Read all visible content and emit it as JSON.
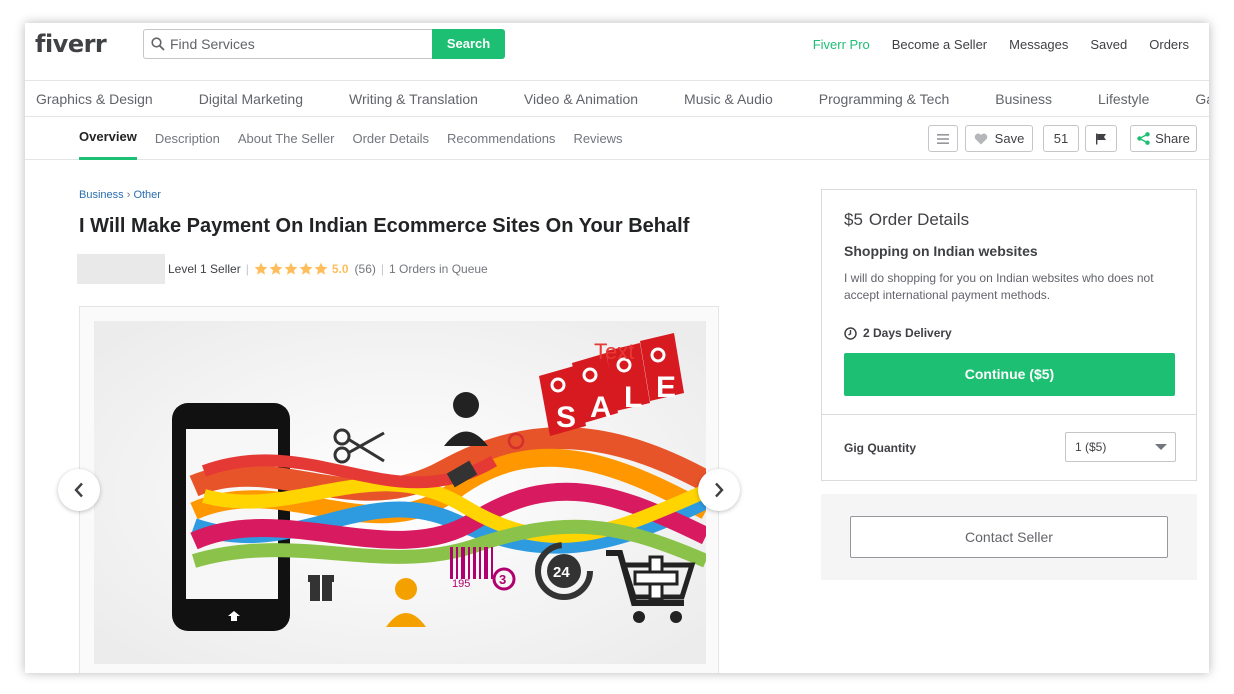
{
  "header": {
    "logo": "fiverr",
    "search_placeholder": "Find Services",
    "search_button": "Search",
    "nav": [
      {
        "label": "Fiverr Pro"
      },
      {
        "label": "Become a Seller"
      },
      {
        "label": "Messages"
      },
      {
        "label": "Saved"
      },
      {
        "label": "Orders"
      }
    ]
  },
  "categories": [
    "Graphics & Design",
    "Digital Marketing",
    "Writing & Translation",
    "Video & Animation",
    "Music & Audio",
    "Programming & Tech",
    "Business",
    "Lifestyle",
    "Gaming"
  ],
  "subnav": {
    "tabs": [
      "Overview",
      "Description",
      "About The Seller",
      "Order Details",
      "Recommendations",
      "Reviews"
    ],
    "active": "Overview",
    "save_label": "Save",
    "save_count": "51",
    "share_label": "Share"
  },
  "gig": {
    "breadcrumb": [
      "Business",
      "Other"
    ],
    "breadcrumb_sep": "›",
    "title": "I Will Make Payment On Indian Ecommerce Sites On Your Behalf",
    "seller_level": "Level 1 Seller",
    "rating": "5.0",
    "rating_stars": 5,
    "review_count": "(56)",
    "queue": "1 Orders in Queue",
    "image_text": {
      "tag_text": "Text",
      "sale_letters": [
        "S",
        "A",
        "L",
        "E"
      ],
      "barcode_number": "195",
      "barcode_digit": "3",
      "clock_number": "24"
    }
  },
  "order": {
    "price": "$5",
    "heading": "Order Details",
    "package_title": "Shopping on Indian websites",
    "description": "I will do shopping for you on Indian websites who does not accept international payment methods.",
    "delivery": "2 Days Delivery",
    "continue_button": "Continue ($5)",
    "quantity_label": "Gig Quantity",
    "quantity_value": "1 ($5)"
  },
  "contact_button": "Contact Seller",
  "colors": {
    "accent": "#1dbf73",
    "star": "#ffbe5b",
    "link": "#2a6eaf"
  }
}
